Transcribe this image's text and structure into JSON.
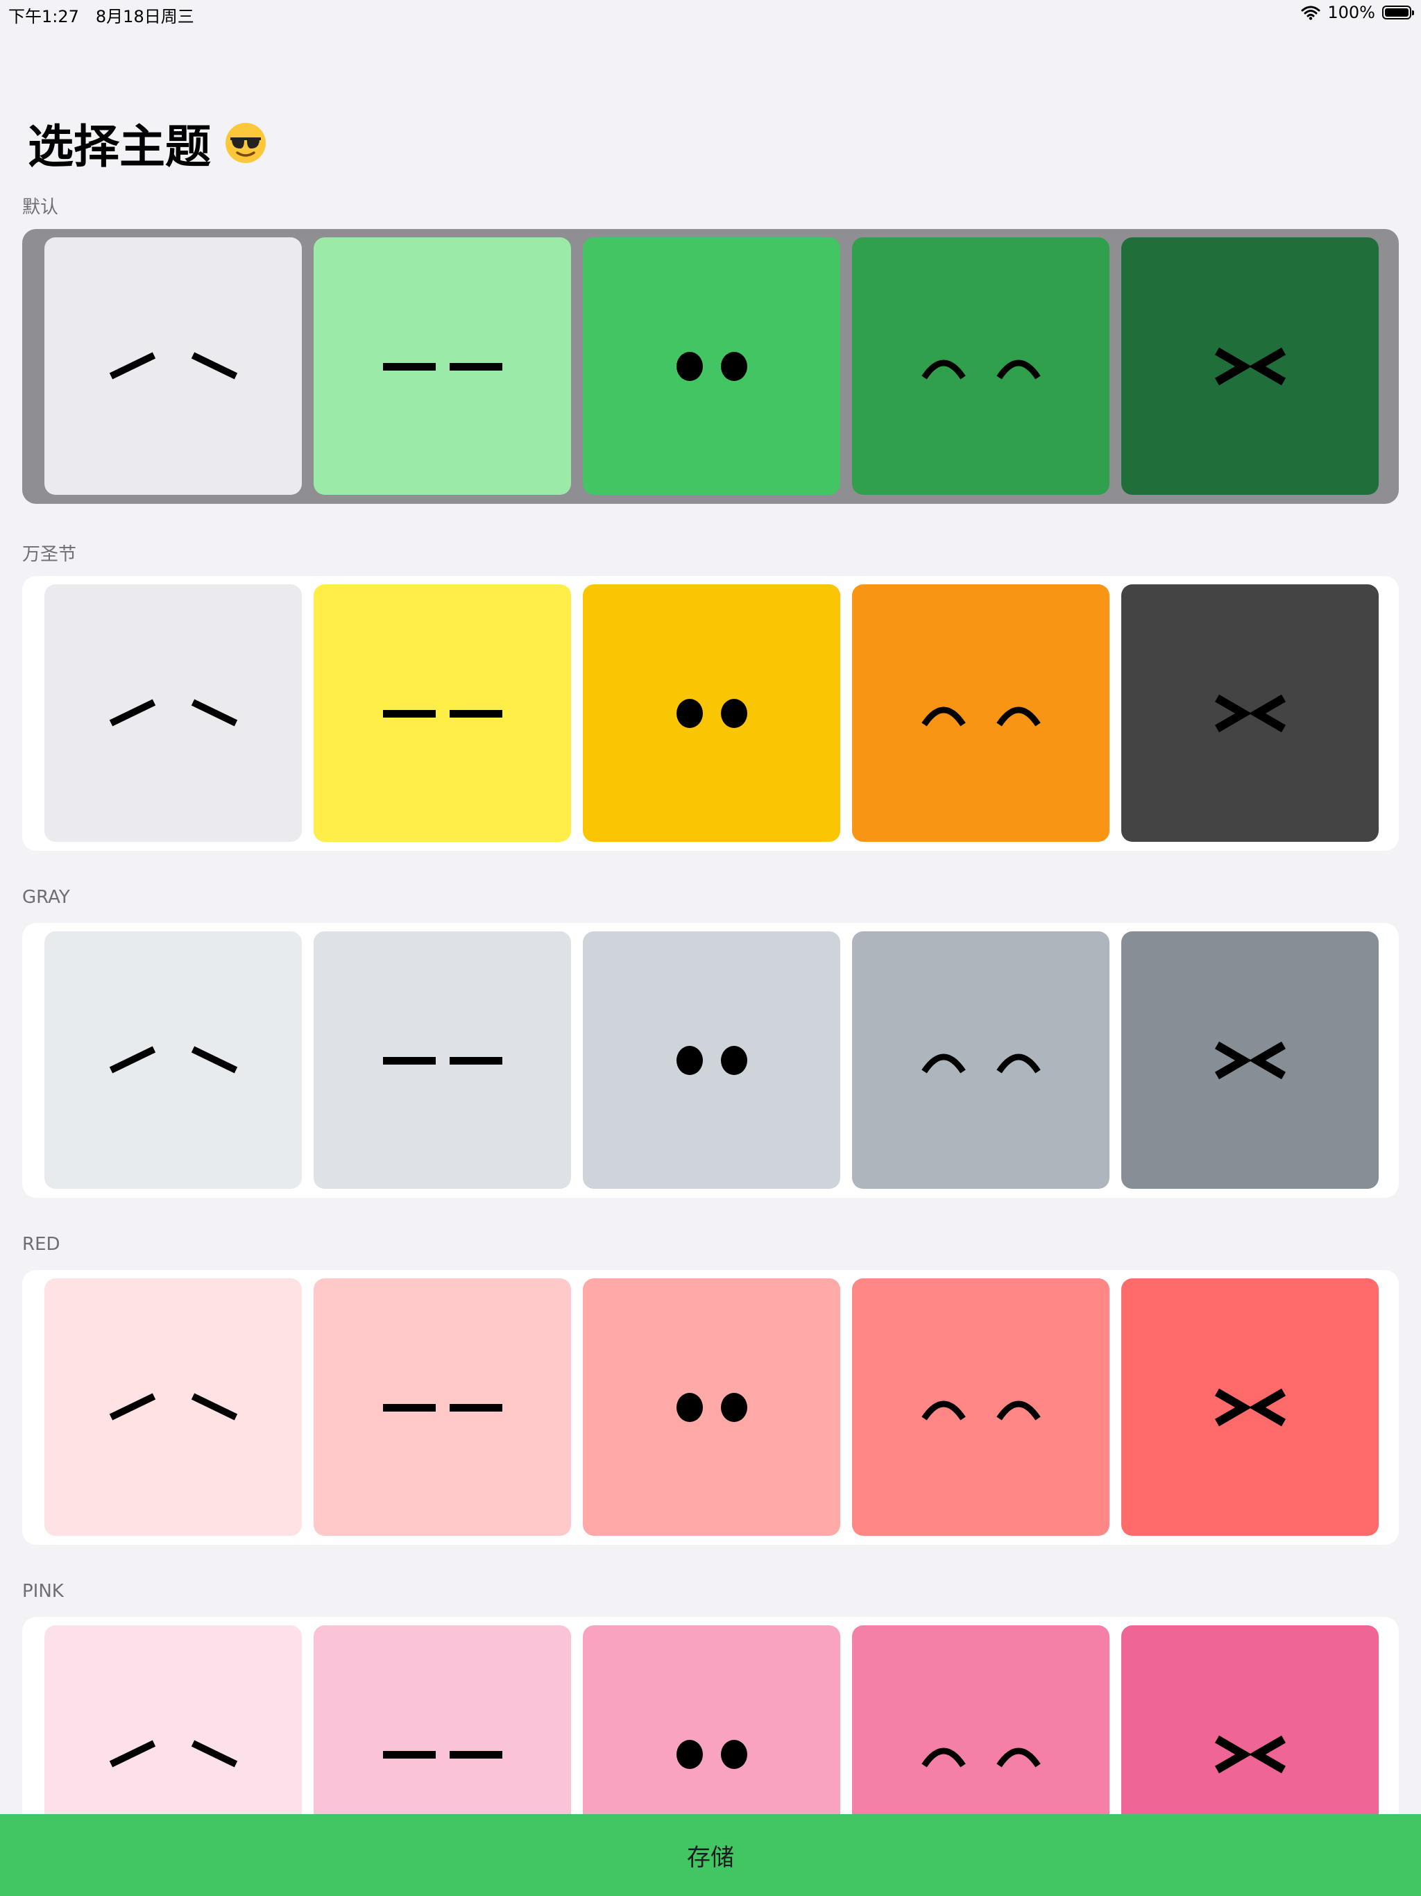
{
  "status_bar": {
    "time": "下午1:27",
    "date": "8月18日周三",
    "battery_text": "100%",
    "battery_level": 1.0
  },
  "header": {
    "title": "选择主题",
    "emoji_icon": "smiling-face-with-sunglasses-icon"
  },
  "faces": [
    "slant-eyes",
    "flat-eyes",
    "dot-eyes",
    "arc-eyes",
    "squint-eyes"
  ],
  "themes": [
    {
      "label": "默认",
      "selected": true,
      "colors": [
        "#ebebef",
        "#9ceaa8",
        "#43c563",
        "#30a04d",
        "#206e3a"
      ]
    },
    {
      "label": "万圣节",
      "selected": false,
      "colors": [
        "#ebebef",
        "#ffee48",
        "#fac503",
        "#f89515",
        "#444444"
      ]
    },
    {
      "label": "GRAY",
      "selected": false,
      "colors": [
        "#e8ebee",
        "#dee1e5",
        "#cfd4db",
        "#adb5bd",
        "#868e96"
      ]
    },
    {
      "label": "RED",
      "selected": false,
      "colors": [
        "#ffe2e3",
        "#ffc9ca",
        "#ffa9a8",
        "#ff8786",
        "#ff6b6a"
      ]
    },
    {
      "label": "PINK",
      "selected": false,
      "colors": [
        "#fde1ea",
        "#fbc3d7",
        "#f8a4c1",
        "#f480a8",
        "#ef6595"
      ]
    }
  ],
  "save_button": {
    "label": "存储"
  },
  "colors": {
    "background": "#f2f2f7",
    "accent": "#42c563",
    "selected_card": "#8e8e93"
  }
}
